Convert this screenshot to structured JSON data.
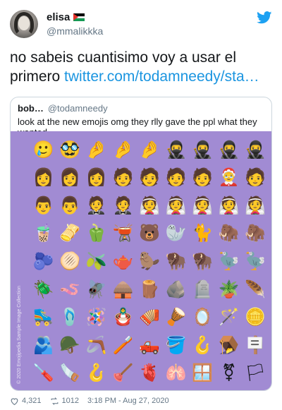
{
  "user": {
    "name": "elisa",
    "handle": "@mmalikkka"
  },
  "tweet": {
    "text": "no sabeis cuantisimo voy a usar el primero ",
    "link": "twitter.com/todamneedy/sta…"
  },
  "quote": {
    "name": "bob…",
    "handle": "@todamneedy",
    "text": "look at the new emojis omg they rlly gave the ppl what they wanted",
    "image_caption": "© 2020 Emojipedia Sample Image Collection",
    "image_bg": "#a18bd3",
    "emojis": [
      "🥲",
      "🥸",
      "🤌",
      "🤌",
      "🤌",
      "🥷",
      "🥷",
      "🥷",
      "🥷",
      "👩",
      "👩",
      "👩",
      "🧑",
      "🧑",
      "🧑",
      "🧑",
      "🤶",
      "🧑",
      "👨",
      "👨",
      "🤵",
      "🤵",
      "👰",
      "👰",
      "👰",
      "👰",
      "👰",
      "🧋",
      "🫔",
      "🫑",
      "🫕",
      "🐻",
      "🦭",
      "🐈",
      "🦣",
      "🦣",
      "🫐",
      "🫓",
      "🫒",
      "🫖",
      "🦫",
      "🦬",
      "🦬",
      "🦤",
      "🦤",
      "🪲",
      "🪱",
      "🪰",
      "🛖",
      "🪵",
      "🪨",
      "🪦",
      "🪴",
      "🪶",
      "🛼",
      "🩴",
      "🪅",
      "🪆",
      "🪗",
      "🪘",
      "🪞",
      "🪄",
      "🪙",
      "🫂",
      "🪖",
      "🪃",
      "🪥",
      "🛻",
      "🪣",
      "🪝",
      "🪤",
      "🪧",
      "🪛",
      "🪚",
      "🪝",
      "🪠",
      "🫀",
      "🫁",
      "🪟",
      "⚧",
      "🏳"
    ]
  },
  "footer": {
    "likes": "4,321",
    "retweets": "1012",
    "timestamp": "3:18 PM - Aug 27, 2020"
  },
  "colors": {
    "link": "#1b95e0",
    "bird": "#1da1f2",
    "muted": "#657786"
  }
}
